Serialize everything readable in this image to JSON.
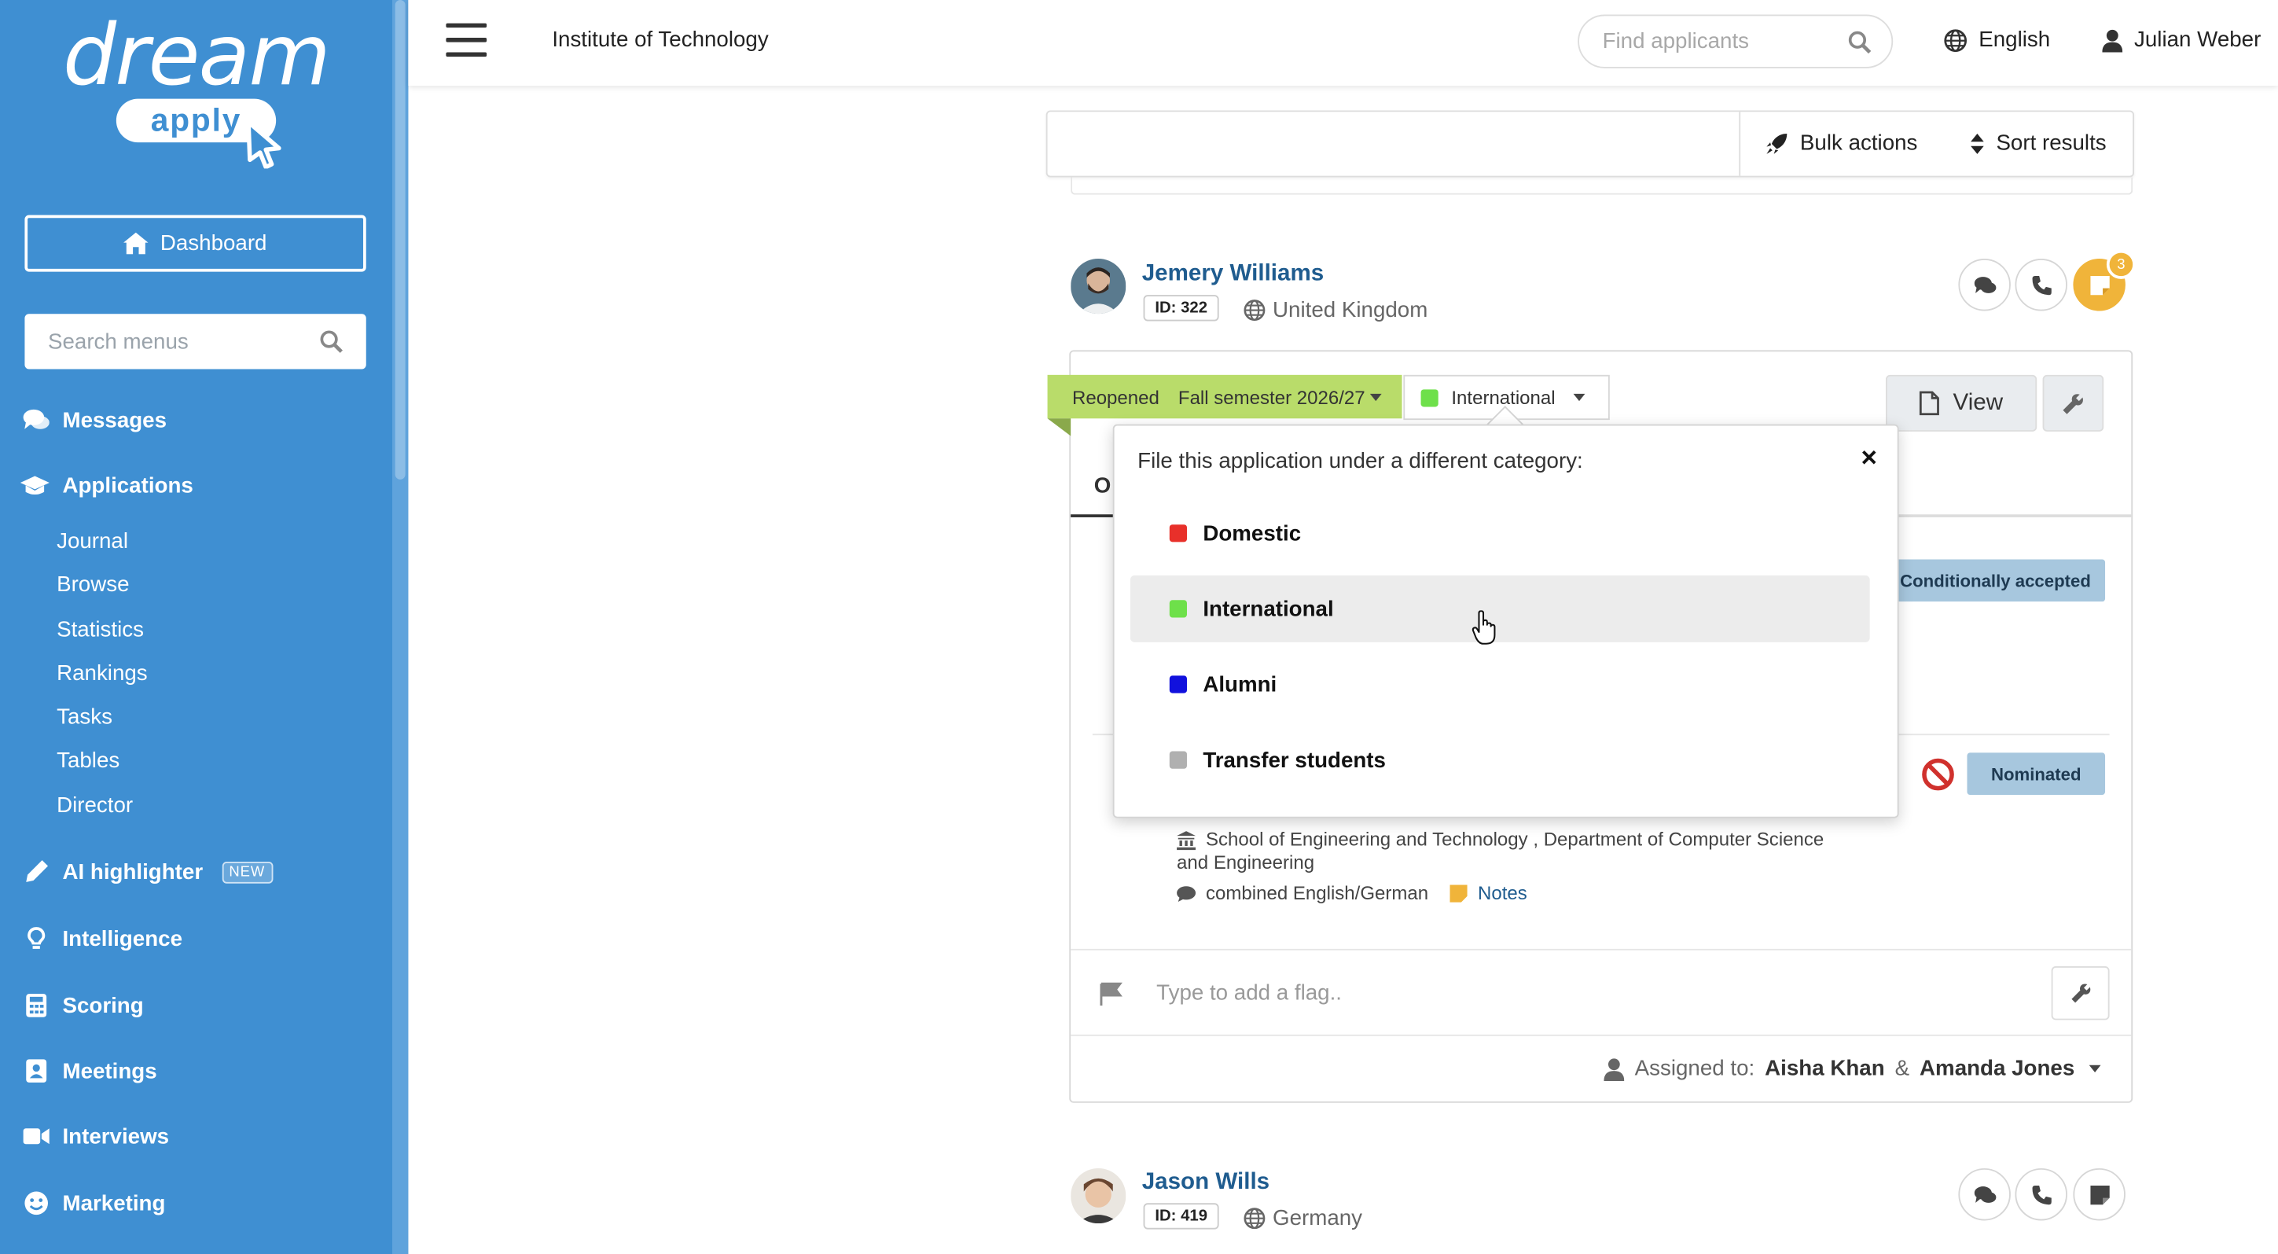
{
  "sidebar": {
    "logo_top": "dream",
    "logo_bottom": "apply",
    "dashboard_label": "Dashboard",
    "search_placeholder": "Search menus",
    "nav": {
      "messages": "Messages",
      "applications": "Applications",
      "ai_highlighter": "AI highlighter",
      "ai_badge": "NEW",
      "intelligence": "Intelligence",
      "scoring": "Scoring",
      "meetings": "Meetings",
      "interviews": "Interviews",
      "marketing": "Marketing"
    },
    "applications_sub": [
      "Journal",
      "Browse",
      "Statistics",
      "Rankings",
      "Tasks",
      "Tables",
      "Director"
    ]
  },
  "header": {
    "institution": "Institute of Technology",
    "find_placeholder": "Find applicants",
    "language": "English",
    "user": "Julian Weber"
  },
  "toolbar": {
    "bulk_actions": "Bulk actions",
    "sort_results": "Sort results"
  },
  "applicants": [
    {
      "name": "Jemery Williams",
      "id": "ID: 322",
      "country": "United Kingdom",
      "notes_count": "3"
    },
    {
      "name": "Jason Wills",
      "id": "ID: 419",
      "country": "Germany"
    }
  ],
  "application": {
    "state": "Reopened",
    "intake": "Fall semester 2026/27",
    "category": "International",
    "category_color": "#6ee04a",
    "view_label": "View",
    "tab_first_letter": "O",
    "status_1": "Conditionally accepted",
    "status_2": "Nominated",
    "school": "School of Engineering and Technology , Department of Computer Science and Engineering",
    "language": "combined English/German",
    "notes_link": "Notes",
    "flag_placeholder": "Type to add a flag..",
    "assigned_label": "Assigned to:",
    "assigned_1": "Aisha Khan",
    "assigned_amp": "&",
    "assigned_2": "Amanda Jones"
  },
  "category_popover": {
    "title": "File this application under a different category:",
    "close": "×",
    "options": [
      {
        "label": "Domestic",
        "color": "#e8302a"
      },
      {
        "label": "International",
        "color": "#6ee04a"
      },
      {
        "label": "Alumni",
        "color": "#1111dd"
      },
      {
        "label": "Transfer students",
        "color": "#b0b0b0"
      }
    ]
  },
  "icons": [
    "home-icon",
    "search-icon",
    "comments-icon",
    "graduation-cap-icon",
    "pen-icon",
    "lightbulb-icon",
    "calculator-icon",
    "calendar-icon",
    "video-icon",
    "smile-icon",
    "globe-icon",
    "user-icon",
    "rocket-icon",
    "sort-icon",
    "phone-icon",
    "sticky-note-icon",
    "file-icon",
    "wrench-icon",
    "flag-icon",
    "ban-icon",
    "university-icon",
    "hand-cursor-icon"
  ]
}
